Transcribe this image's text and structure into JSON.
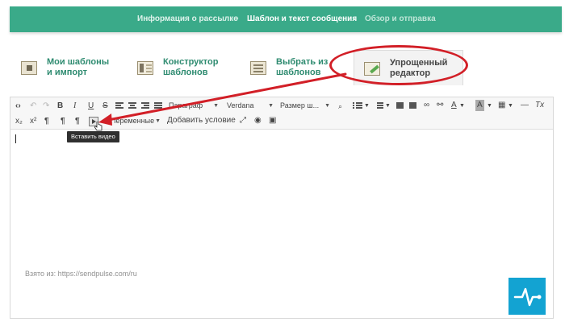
{
  "stepper": {
    "step1": "Информация о рассылке",
    "step2": "Шаблон и текст сообщения",
    "step3": "Обзор и отправка",
    "separator": "›"
  },
  "tabs": [
    {
      "label_line1": "Мои шаблоны",
      "label_line2": "и импорт",
      "icon": "import-icon"
    },
    {
      "label_line1": "Конструктор",
      "label_line2": "шаблонов",
      "icon": "constructor-icon"
    },
    {
      "label_line1": "Выбрать из",
      "label_line2": "шаблонов",
      "icon": "template-list-icon"
    },
    {
      "label_line1": "Упрощенный",
      "label_line2": "редактор",
      "icon": "simple-editor-icon"
    }
  ],
  "toolbar": {
    "source": "‹›",
    "undo": "↶",
    "redo": "↷",
    "bold": "B",
    "italic": "I",
    "underline": "U",
    "strike": "S",
    "paragraph_select": "Параграф",
    "font_select": "Verdana",
    "size_select": "Размер ш...",
    "variables": "Переменные",
    "add_condition": "Добавить условие",
    "subscript": "x₂",
    "superscript": "x²",
    "ltr": "¶",
    "rtl": "¶",
    "pilcrow": "¶",
    "text_color": "A",
    "bg_color": "A",
    "clear_format": "Tx",
    "hr": "—"
  },
  "tooltip": "Вставить видео",
  "source_text": "Взято из: https://sendpulse.com/ru",
  "colors": {
    "brand_green": "#3aaa89",
    "highlight_red": "#d21f27",
    "logo_blue": "#13a3d2"
  }
}
